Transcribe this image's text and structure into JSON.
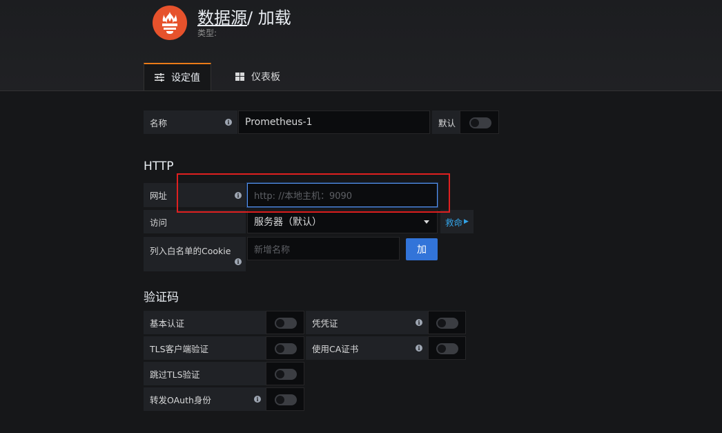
{
  "header": {
    "logo_icon": "prometheus-logo-icon",
    "title_link": "数据源",
    "title_rest": "/ 加载",
    "subtitle": "类型:"
  },
  "tabs": [
    {
      "label": "设定值",
      "icon": "sliders-icon",
      "active": true
    },
    {
      "label": "仪表板",
      "icon": "dashboard-grid-icon",
      "active": false
    }
  ],
  "name_row": {
    "label": "名称",
    "value": "Prometheus-1",
    "default_label": "默认"
  },
  "http": {
    "title": "HTTP",
    "url_label": "网址",
    "url_placeholder": "http: //本地主机：9090",
    "access_label": "访问",
    "access_value": "服务器（默认）",
    "help_label": "救命",
    "cookie_label": "列入白名单的Cookie",
    "cookie_placeholder": "新增名称",
    "add_button": "加"
  },
  "auth": {
    "title": "验证码",
    "items": [
      {
        "label": "基本认证"
      },
      {
        "label": "凭凭证"
      },
      {
        "label": "TLS客户端验证"
      },
      {
        "label": "使用CA证书"
      },
      {
        "label": "跳过TLS验证"
      },
      {
        "label": "转发OAuth身份"
      }
    ]
  },
  "colors": {
    "accent": "#eb7b18",
    "primary_button": "#3274d9",
    "link": "#33a2e5",
    "highlight_box": "#e02020"
  }
}
